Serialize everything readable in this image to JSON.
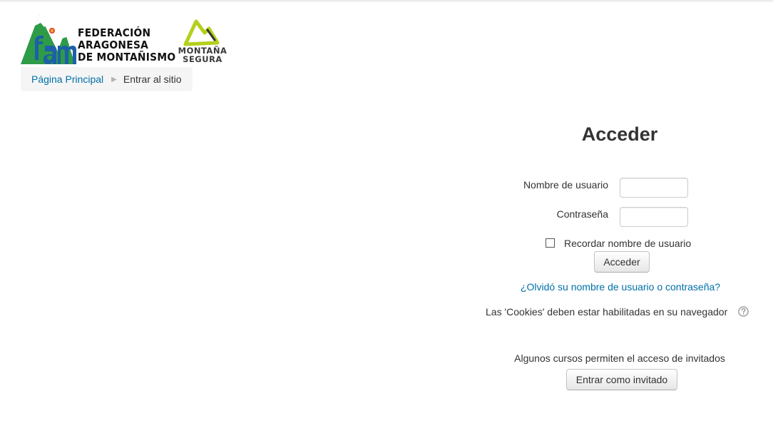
{
  "header": {
    "org_logo": {
      "line1": "FEDERACIÓN",
      "line2": "ARAGONESA",
      "line3": "DE MONTAÑISMO",
      "initials": "fam"
    },
    "partner_logo": {
      "line1": "MONTAÑA",
      "line2": "SEGURA"
    }
  },
  "breadcrumb": {
    "home": "Página Principal",
    "current": "Entrar al sitio"
  },
  "login": {
    "title": "Acceder",
    "username_label": "Nombre de usuario",
    "username_value": "",
    "password_label": "Contraseña",
    "password_value": "",
    "remember_label": "Recordar nombre de usuario",
    "remember_checked": false,
    "submit_label": "Acceder",
    "forgot_link": "¿Olvidó su nombre de usuario o contraseña?",
    "cookies_notice": "Las 'Cookies' deben estar habilitadas en su navegador",
    "help_icon": "question-circle-icon"
  },
  "guest": {
    "notice": "Algunos cursos permiten el acceso de invitados",
    "button_label": "Entrar como invitado"
  },
  "colors": {
    "link": "#0070a8",
    "logo_green": "#2e9b48",
    "logo_blue": "#1d5fa8",
    "partner_lime": "#b5cf1c"
  }
}
